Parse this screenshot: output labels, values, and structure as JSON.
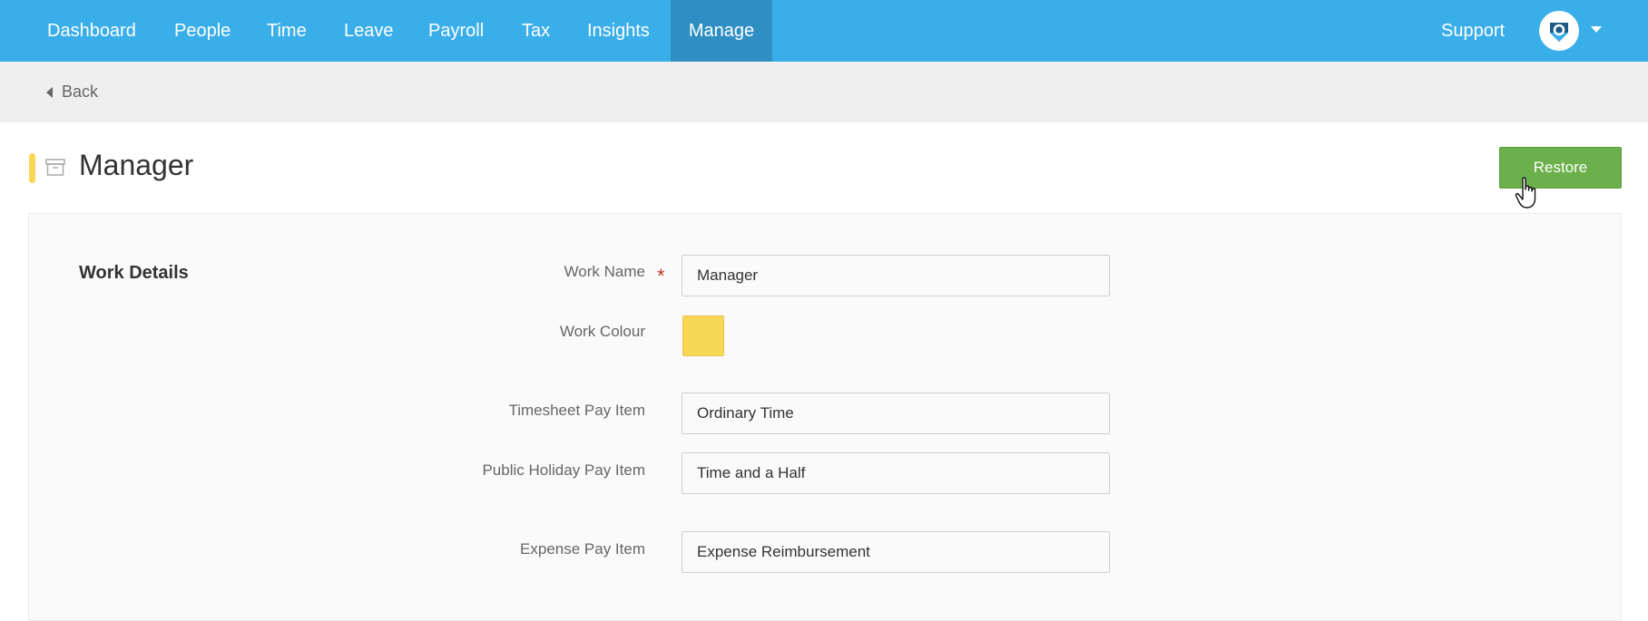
{
  "nav": {
    "items": [
      {
        "label": "Dashboard",
        "active": false
      },
      {
        "label": "People",
        "active": false
      },
      {
        "label": "Time",
        "active": false
      },
      {
        "label": "Leave",
        "active": false
      },
      {
        "label": "Payroll",
        "active": false
      },
      {
        "label": "Tax",
        "active": false
      },
      {
        "label": "Insights",
        "active": false
      },
      {
        "label": "Manage",
        "active": true
      }
    ],
    "support_label": "Support",
    "avatar_icon": "heart-shield-icon",
    "menu_icon": "chevron-down-icon"
  },
  "subbar": {
    "back_label": "Back"
  },
  "page": {
    "title": "Manager",
    "title_icon": "archive-icon",
    "restore_label": "Restore"
  },
  "form": {
    "section_title": "Work Details",
    "work_name": {
      "label": "Work Name",
      "value": "Manager",
      "required": true
    },
    "work_colour": {
      "label": "Work Colour",
      "value": "#f8d656"
    },
    "timesheet_pay_item": {
      "label": "Timesheet Pay Item",
      "value": "Ordinary Time"
    },
    "public_holiday_pay_item": {
      "label": "Public Holiday Pay Item",
      "value": "Time and a Half"
    },
    "expense_pay_item": {
      "label": "Expense Pay Item",
      "value": "Expense Reimbursement"
    }
  },
  "colors": {
    "nav_bg": "#3aaee9",
    "nav_active_bg": "#2f8fc3",
    "restore_green": "#6bb04a",
    "work_colour": "#f8d656"
  }
}
